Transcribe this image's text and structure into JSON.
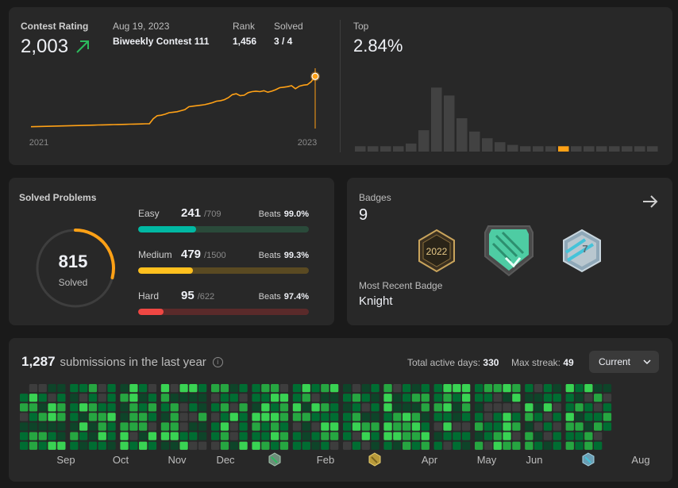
{
  "rating": {
    "title": "Contest Rating",
    "value": "2,003",
    "date": "Aug 19, 2023",
    "contest": "Biweekly Contest 111",
    "rank_label": "Rank",
    "rank_value": "1,456",
    "solved_label": "Solved",
    "solved_value": "3 / 4",
    "top_label": "Top",
    "top_value": "2.84%",
    "colors": {
      "line": "#ffa116",
      "up": "#2cbb5d",
      "hist": "#424242",
      "hist_highlight": "#ffa116"
    }
  },
  "chart_data": [
    {
      "type": "line",
      "x_tick_labels": [
        "2021",
        "2023"
      ],
      "values": [
        1500,
        1501,
        1502,
        1503,
        1504,
        1505,
        1506,
        1507,
        1508,
        1509,
        1510,
        1511,
        1512,
        1513,
        1514,
        1515,
        1516,
        1517,
        1518,
        1519,
        1520,
        1521,
        1522,
        1523,
        1524,
        1525,
        1526,
        1527,
        1528,
        1529,
        1530,
        1580,
        1610,
        1615,
        1625,
        1640,
        1645,
        1650,
        1660,
        1670,
        1700,
        1705,
        1710,
        1715,
        1720,
        1730,
        1740,
        1755,
        1760,
        1770,
        1790,
        1820,
        1830,
        1810,
        1815,
        1840,
        1850,
        1855,
        1850,
        1860,
        1845,
        1855,
        1870,
        1890,
        1895,
        1900,
        1910,
        1880,
        1905,
        1915,
        1920,
        1950,
        2003
      ],
      "ylim": [
        1450,
        2100
      ]
    },
    {
      "type": "bar",
      "values": [
        4,
        4,
        4,
        4,
        6,
        16,
        48,
        42,
        25,
        15,
        10,
        7,
        5,
        4,
        4,
        4,
        4,
        4,
        4,
        4,
        4,
        4,
        4,
        4
      ],
      "highlight_index": 16,
      "ylim": [
        0,
        50
      ]
    }
  ],
  "solved": {
    "title": "Solved Problems",
    "total": "815",
    "total_label": "Solved",
    "total_fraction": 0.29,
    "levels": [
      {
        "name": "Easy",
        "solved": "241",
        "total": "/709",
        "beats_label": "Beats",
        "beats": "99.0%",
        "fraction": 0.34,
        "color": "#00b8a3",
        "track": "#2a4a3a"
      },
      {
        "name": "Medium",
        "solved": "479",
        "total": "/1500",
        "beats_label": "Beats",
        "beats": "99.3%",
        "fraction": 0.32,
        "color": "#ffc01e",
        "track": "#5a4a22"
      },
      {
        "name": "Hard",
        "solved": "95",
        "total": "/622",
        "beats_label": "Beats",
        "beats": "97.4%",
        "fraction": 0.15,
        "color": "#ef4743",
        "track": "#5a2a2a"
      }
    ]
  },
  "badges": {
    "title": "Badges",
    "count": "9",
    "recent_label": "Most Recent Badge",
    "recent_value": "Knight",
    "icons": [
      "2022-annual-badge-icon",
      "knight-badge-icon",
      "50-days-badge-icon"
    ]
  },
  "heatmap": {
    "count": "1,287",
    "title_suffix": "submissions in the last year",
    "active_label": "Total active days:",
    "active_value": "330",
    "streak_label": "Max streak:",
    "streak_value": "49",
    "select_value": "Current",
    "months": [
      "Sep",
      "Oct",
      "Nov",
      "Dec",
      "Feb",
      "Apr",
      "May",
      "Jun",
      "Aug"
    ],
    "colors": [
      "#3d3d3d",
      "#0e4429",
      "#006d32",
      "#26a641",
      "#39d353"
    ]
  }
}
